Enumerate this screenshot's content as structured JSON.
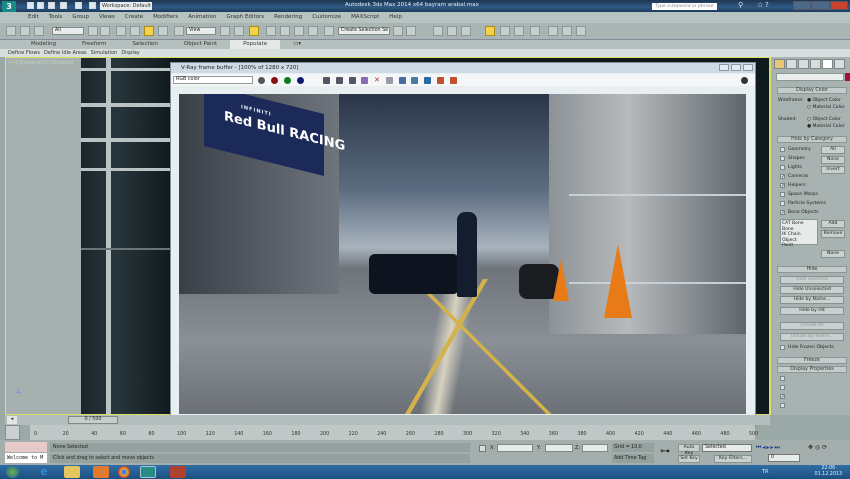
{
  "titlebar": {
    "app_logo": "3",
    "workspace": "Workspace: Default",
    "title": "Autodesk 3ds Max 2014 x64   bayram arabal.max",
    "search_placeholder": "Type a keyword or phrase"
  },
  "menu": [
    "Edit",
    "Tools",
    "Group",
    "Views",
    "Create",
    "Modifiers",
    "Animation",
    "Graph Editors",
    "Rendering",
    "Customize",
    "MAXScript",
    "Help"
  ],
  "toolbar": {
    "selection_filter": "All",
    "reference_coord": "View",
    "named_selection": "Create Selection Se"
  },
  "ribbon": {
    "tabs": [
      "Modeling",
      "Freeform",
      "Selection",
      "Object Paint",
      "Populate"
    ],
    "active_tab": "Populate",
    "subtabs": [
      "Define Flows",
      "Define Idle Areas",
      "Simulation",
      "Display"
    ]
  },
  "viewport": {
    "label": "[+] [Camera01] [Shaded]"
  },
  "vfb": {
    "title": "V-Ray frame buffer - [100% of 1280 x 720]",
    "channel": "RGB color",
    "swatch_colors": [
      "#8a1010",
      "#0e7a1e",
      "#111a70"
    ],
    "banner_text": "Red Bull RACING",
    "tail_text": "INFINITI"
  },
  "command_panel": {
    "display_color": {
      "header": "Display Color",
      "wireframe_label": "Wireframe:",
      "shaded_label": "Shaded:",
      "object_color": "Object Color",
      "material_color": "Material Color"
    },
    "hide_by_category": {
      "header": "Hide by Category",
      "items": [
        {
          "label": "Geometry",
          "checked": false
        },
        {
          "label": "Shapes",
          "checked": false
        },
        {
          "label": "Lights",
          "checked": false
        },
        {
          "label": "Cameras",
          "checked": true
        },
        {
          "label": "Helpers",
          "checked": true
        },
        {
          "label": "Space Warps",
          "checked": false
        },
        {
          "label": "Particle Systems",
          "checked": false
        },
        {
          "label": "Bone Objects",
          "checked": true
        }
      ],
      "all": "All",
      "none": "None",
      "invert": "Invert",
      "list": [
        "CAT Bone",
        "Bone",
        "IK Chain Object",
        "Point"
      ],
      "add": "Add",
      "remove": "Remove",
      "none2": "None"
    },
    "hide": {
      "header": "Hide",
      "buttons": [
        "Hide Selected",
        "Hide Unselected",
        "Hide by Name...",
        "Hide by Hit",
        "Unhide All",
        "Unhide by Name..."
      ],
      "hide_frozen": "Hide Frozen Objects"
    },
    "freeze": {
      "header": "Freeze"
    },
    "display_properties": {
      "header": "Display Properties"
    }
  },
  "timeline": {
    "frame": "0 / 500",
    "ticks": [
      "0",
      "20",
      "40",
      "60",
      "80",
      "100",
      "120",
      "140",
      "160",
      "180",
      "200",
      "220",
      "240",
      "260",
      "280",
      "300",
      "320",
      "340",
      "360",
      "380",
      "400",
      "420",
      "440",
      "460",
      "480",
      "500"
    ]
  },
  "status": {
    "maxscript": "Welcome to M",
    "selection": "None Selected",
    "prompt": "Click and drag to select and move objects",
    "x_label": "X:",
    "y_label": "Y:",
    "z_label": "Z:",
    "grid": "Grid = 10,0",
    "add_time_tag": "Add Time Tag",
    "auto_key": "Auto Key",
    "key_mode": "Selected",
    "set_key": "Set Key",
    "key_filters": "Key Filters...",
    "current_frame": "0"
  },
  "taskbar": {
    "language": "TR",
    "time": "22:06",
    "date": "01.12.2013"
  }
}
